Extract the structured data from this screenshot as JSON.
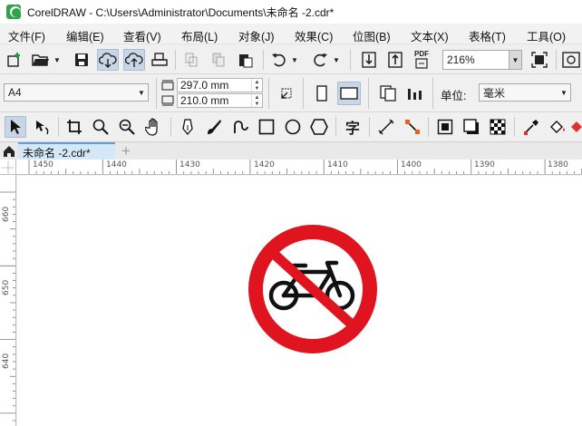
{
  "window": {
    "title": "CorelDRAW - C:\\Users\\Administrator\\Documents\\未命名 -2.cdr*"
  },
  "menu": {
    "items": [
      "文件(F)",
      "编辑(E)",
      "查看(V)",
      "布局(L)",
      "对象(J)",
      "效果(C)",
      "位图(B)",
      "文本(X)",
      "表格(T)",
      "工具(O)"
    ]
  },
  "toolbar_standard": {
    "zoom_value": "216%",
    "pdf_label": "PDF"
  },
  "property_bar": {
    "page_size": "A4",
    "width_value": "297.0 mm",
    "height_value": "210.0 mm",
    "units_label": "单位:",
    "units_value": "毫米"
  },
  "toolbox": {
    "text_tool_glyph": "字"
  },
  "document_tabs": {
    "active_tab": "未命名 -2.cdr*",
    "add_tab": "+"
  },
  "rulers": {
    "horizontal_ticks": [
      "1450",
      "1440",
      "1430",
      "1420",
      "1410",
      "1400",
      "1390",
      "1380"
    ],
    "vertical_ticks": [
      "660",
      "650",
      "640"
    ]
  },
  "colors": {
    "sign_red": "#e0141e",
    "sign_black": "#111111",
    "active_tab": "#d6e8f8",
    "app_green": "#2da44a"
  },
  "canvas_object": {
    "icon": "no-bicycle-sign"
  }
}
